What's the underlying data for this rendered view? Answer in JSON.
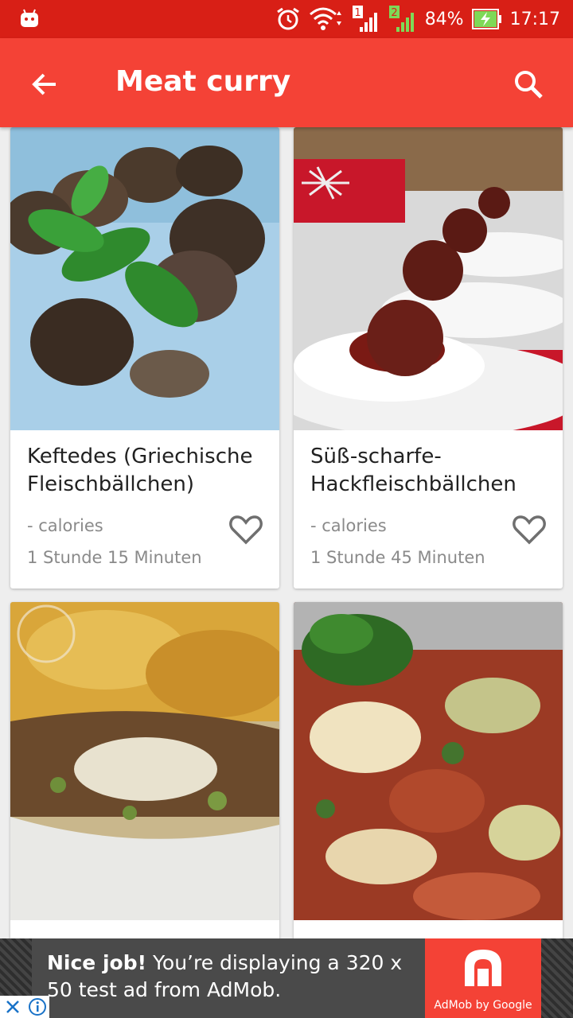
{
  "status_bar": {
    "battery": "84%",
    "time": "17:17",
    "sim1_label": "1",
    "sim2_label": "2"
  },
  "app_bar": {
    "title": "Meat curry",
    "back_icon": "arrow-back-icon",
    "search_icon": "search-icon"
  },
  "recipes": [
    {
      "title": "Keftedes (Griechische Fleischbällchen)",
      "calories": "- calories",
      "time": "1 Stunde 15 Minuten"
    },
    {
      "title": "Süß-scharfe-Hackfleischbällchen",
      "calories": "- calories",
      "time": "1 Stunde 45 Minuten"
    },
    {
      "title": "",
      "calories": "",
      "time": ""
    },
    {
      "title": "",
      "calories": "",
      "time": ""
    }
  ],
  "ad": {
    "headline": "Nice job!",
    "body": " You’re displaying a 320 x 50 test ad from AdMob.",
    "logo_label": "AdMob by Google"
  },
  "colors": {
    "status_bar": "#d81f16",
    "app_bar": "#f44236",
    "accent": "#f44236"
  }
}
